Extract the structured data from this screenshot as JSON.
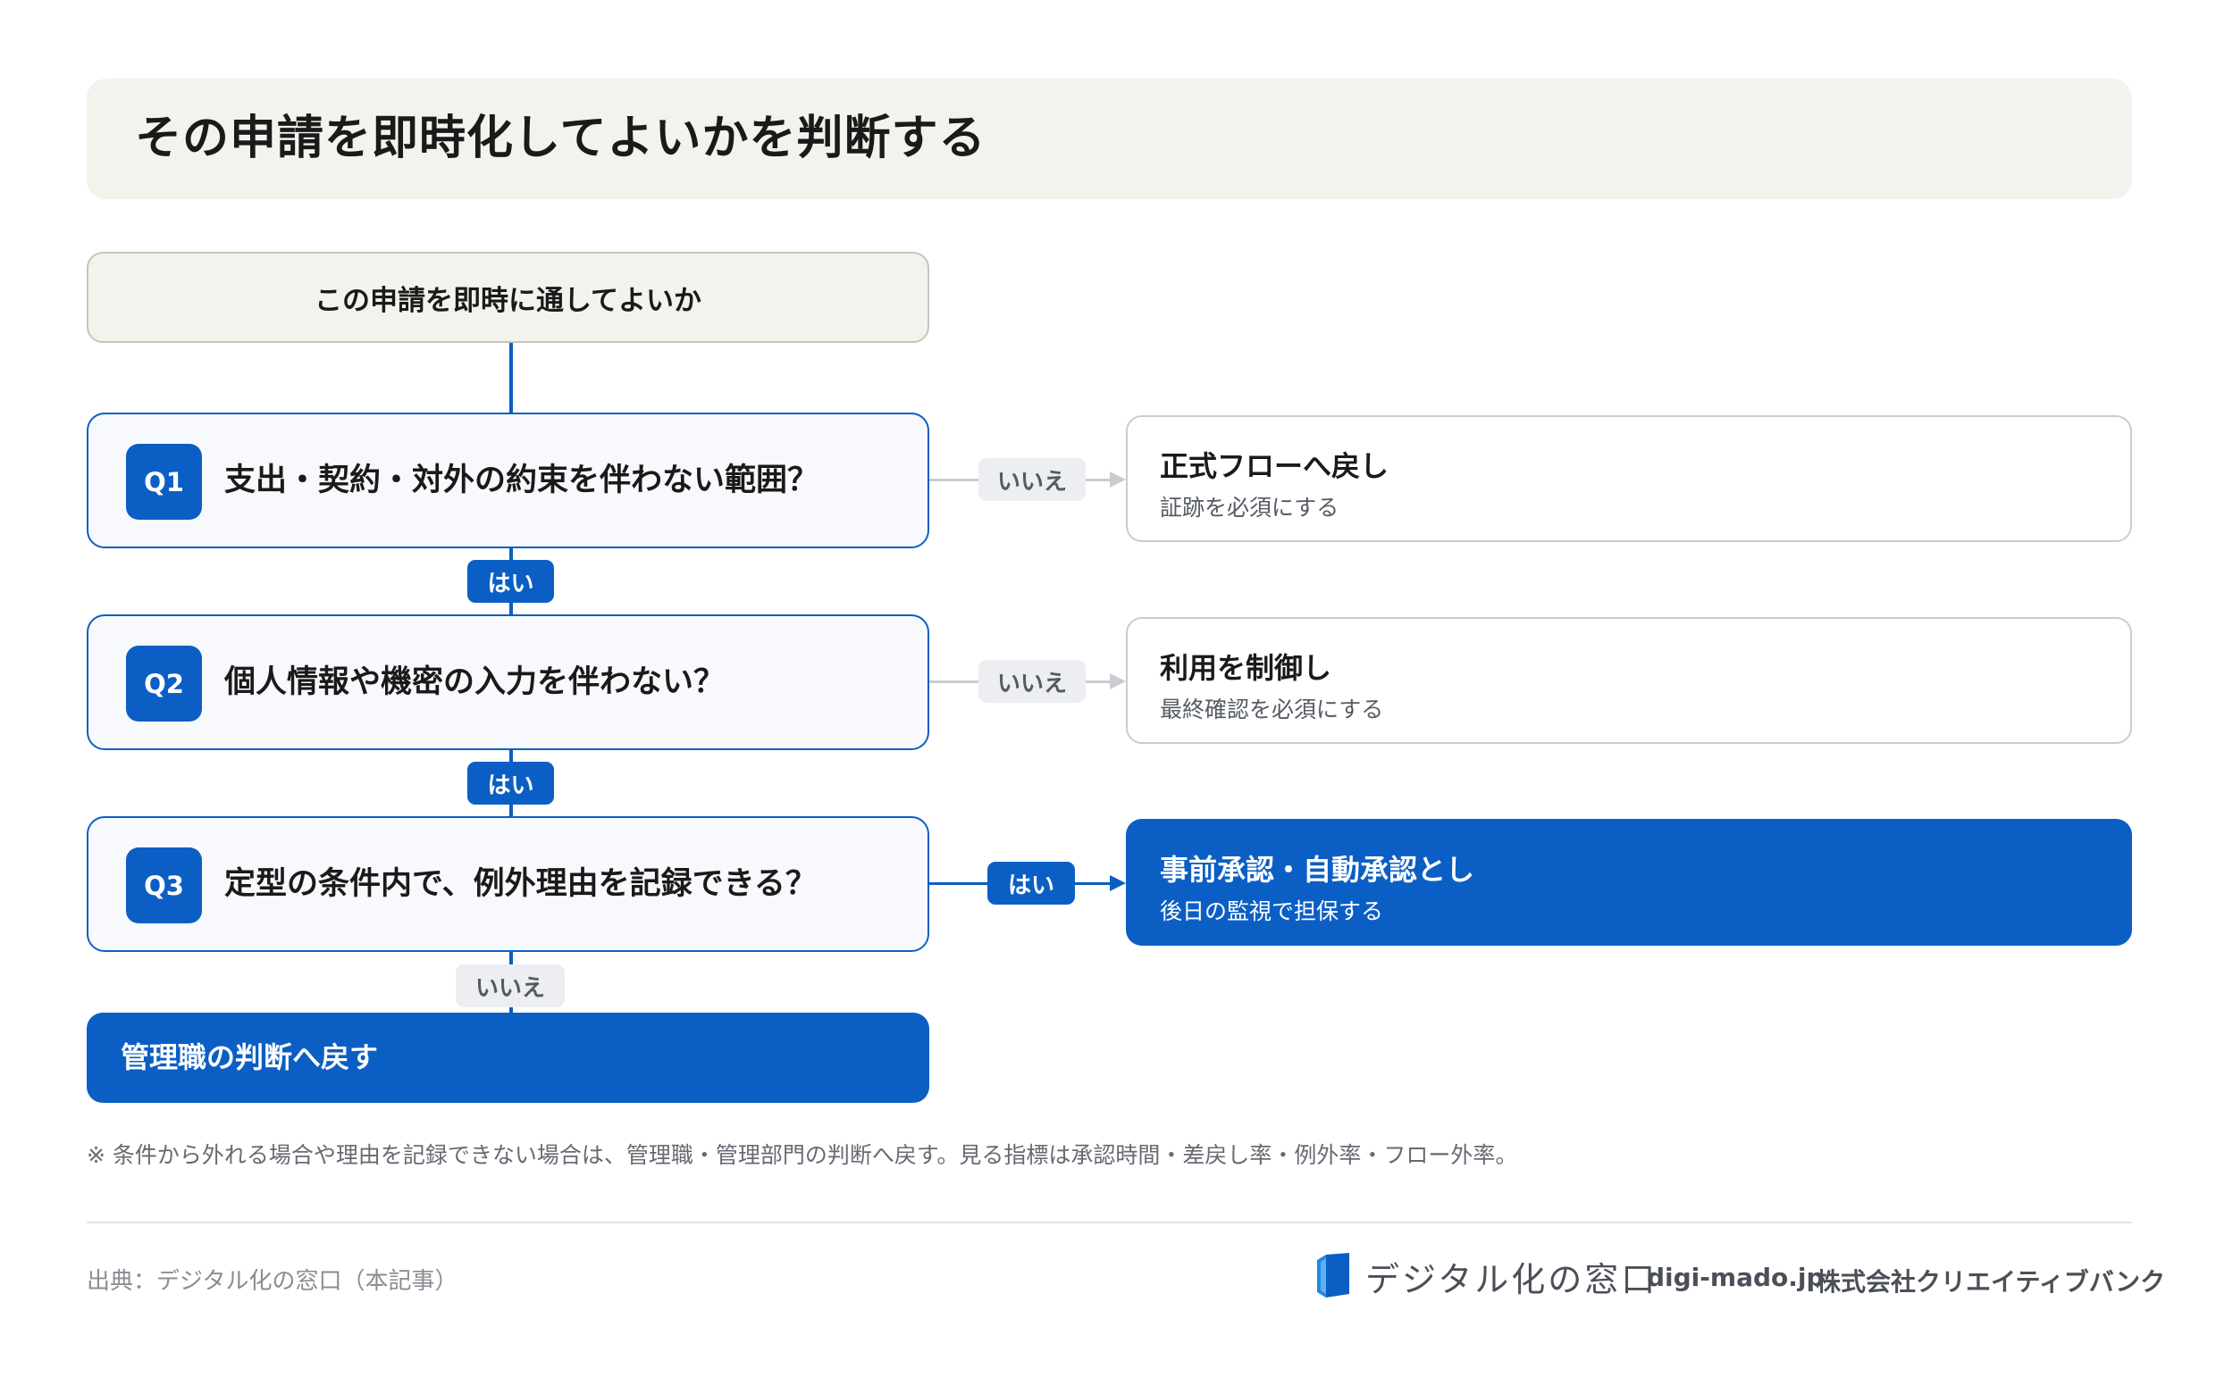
{
  "title": "その申請を即時化してよいかを判断する",
  "start": "この申請を即時に通してよいか",
  "questions": [
    {
      "badge": "Q1",
      "text": "支出・契約・対外の約束を伴わない範囲？"
    },
    {
      "badge": "Q2",
      "text": "個人情報や機密の入力を伴わない？"
    },
    {
      "badge": "Q3",
      "text": "定型の条件内で、例外理由を記録できる？"
    }
  ],
  "labels": {
    "yes": "はい",
    "no": "いいえ"
  },
  "results": [
    {
      "title": "正式フローへ戻し",
      "sub": "証跡を必須にする"
    },
    {
      "title": "利用を制御し",
      "sub": "最終確認を必須にする"
    },
    {
      "title": "事前承認・自動承認とし",
      "sub": "後日の監視で担保する"
    }
  ],
  "final": "管理職の判断へ戻す",
  "note": "※ 条件から外れる場合や理由を記録できない場合は、管理職・管理部門の判断へ戻す。見る指標は承認時間・差戻し率・例外率・フロー外率。",
  "footer": {
    "source": "出典：デジタル化の窓口（本記事）",
    "brand": "デジタル化の窓口",
    "url": "digi-mado.jp",
    "company": "株式会社クリエイティブバンク"
  },
  "colors": {
    "accent": "#0b5fc4",
    "beige": "#f4f2ec",
    "grey_line": "#c9ccd2"
  }
}
